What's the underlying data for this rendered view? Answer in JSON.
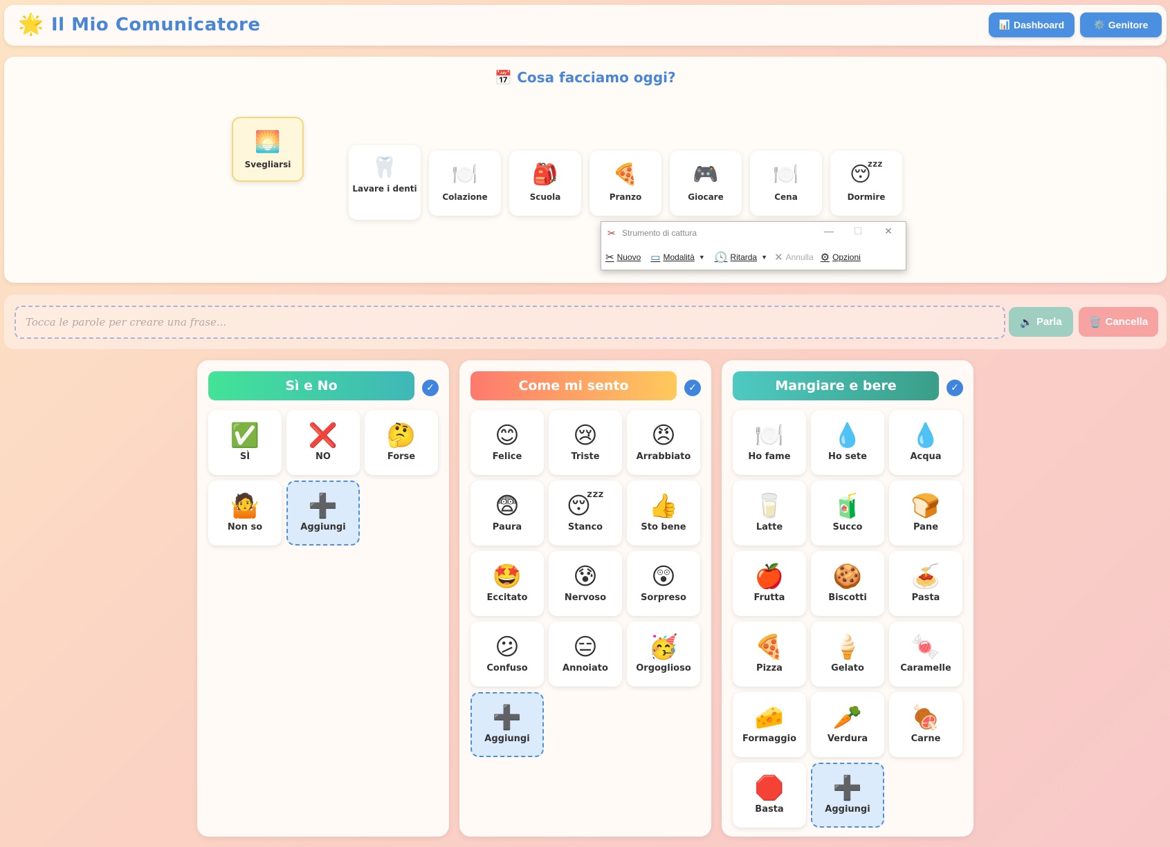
{
  "header": {
    "logo_glyph": "🌟",
    "title": "Il Mio Comunicatore",
    "dashboard_icon": "📊",
    "dashboard_label": "Dashboard",
    "parent_icon": "⚙️",
    "parent_label": "Genitore"
  },
  "routine": {
    "title_icon": "📅",
    "title": "Cosa facciamo oggi?",
    "items": [
      {
        "icon": "🌅",
        "label": "Svegliarsi",
        "active": true
      },
      {
        "icon": "🦷",
        "label": "Lavare i denti"
      },
      {
        "icon": "🍽️",
        "label": "Colazione"
      },
      {
        "icon": "🎒",
        "label": "Scuola"
      },
      {
        "icon": "🍕",
        "label": "Pranzo"
      },
      {
        "icon": "🎮",
        "label": "Giocare"
      },
      {
        "icon": "🍽️",
        "label": "Cena"
      },
      {
        "icon": "😴",
        "label": "Dormire"
      }
    ]
  },
  "snipping_tool": {
    "title": "Strumento di cattura",
    "tools": [
      "Nuovo",
      "Modalità",
      "Ritarda",
      "Annulla",
      "Opzioni"
    ]
  },
  "sentence": {
    "placeholder": "Tocca le parole per creare una frase...",
    "speak_icon": "🔊",
    "speak_label": "Parla",
    "clear_icon": "🗑️",
    "clear_label": "Cancella"
  },
  "panels": [
    {
      "title": "Sì e No",
      "tiles": [
        {
          "icon": "✅",
          "label": "SÌ"
        },
        {
          "icon": "❌",
          "label": "NO"
        },
        {
          "icon": "🤔",
          "label": "Forse"
        },
        {
          "icon": "🤷",
          "label": "Non so"
        },
        {
          "icon": "➕",
          "label": "Aggiungi",
          "add": true
        }
      ]
    },
    {
      "title": "Come mi sento",
      "tiles": [
        {
          "icon": "😊",
          "label": "Felice"
        },
        {
          "icon": "😢",
          "label": "Triste"
        },
        {
          "icon": "😠",
          "label": "Arrabbiato"
        },
        {
          "icon": "😨",
          "label": "Paura"
        },
        {
          "icon": "😴",
          "label": "Stanco"
        },
        {
          "icon": "👍",
          "label": "Sto bene"
        },
        {
          "icon": "🤩",
          "label": "Eccitato"
        },
        {
          "icon": "😰",
          "label": "Nervoso"
        },
        {
          "icon": "😲",
          "label": "Sorpreso"
        },
        {
          "icon": "😕",
          "label": "Confuso"
        },
        {
          "icon": "😑",
          "label": "Annoiato"
        },
        {
          "icon": "🥳",
          "label": "Orgoglioso"
        },
        {
          "icon": "➕",
          "label": "Aggiungi",
          "add": true
        }
      ]
    },
    {
      "title": "Mangiare e bere",
      "tiles": [
        {
          "icon": "🍽️",
          "label": "Ho fame"
        },
        {
          "icon": "💧",
          "label": "Ho sete"
        },
        {
          "icon": "💧",
          "label": "Acqua"
        },
        {
          "icon": "🥛",
          "label": "Latte"
        },
        {
          "icon": "🧃",
          "label": "Succo"
        },
        {
          "icon": "🍞",
          "label": "Pane"
        },
        {
          "icon": "🍎",
          "label": "Frutta"
        },
        {
          "icon": "🍪",
          "label": "Biscotti"
        },
        {
          "icon": "🍝",
          "label": "Pasta"
        },
        {
          "icon": "🍕",
          "label": "Pizza"
        },
        {
          "icon": "🍦",
          "label": "Gelato"
        },
        {
          "icon": "🍬",
          "label": "Caramelle"
        },
        {
          "icon": "🧀",
          "label": "Formaggio"
        },
        {
          "icon": "🥕",
          "label": "Verdura"
        },
        {
          "icon": "🍖",
          "label": "Carne"
        },
        {
          "icon": "🛑",
          "label": "Basta"
        },
        {
          "icon": "➕",
          "label": "Aggiungi",
          "add": true
        }
      ]
    }
  ],
  "checkmark": "✓"
}
